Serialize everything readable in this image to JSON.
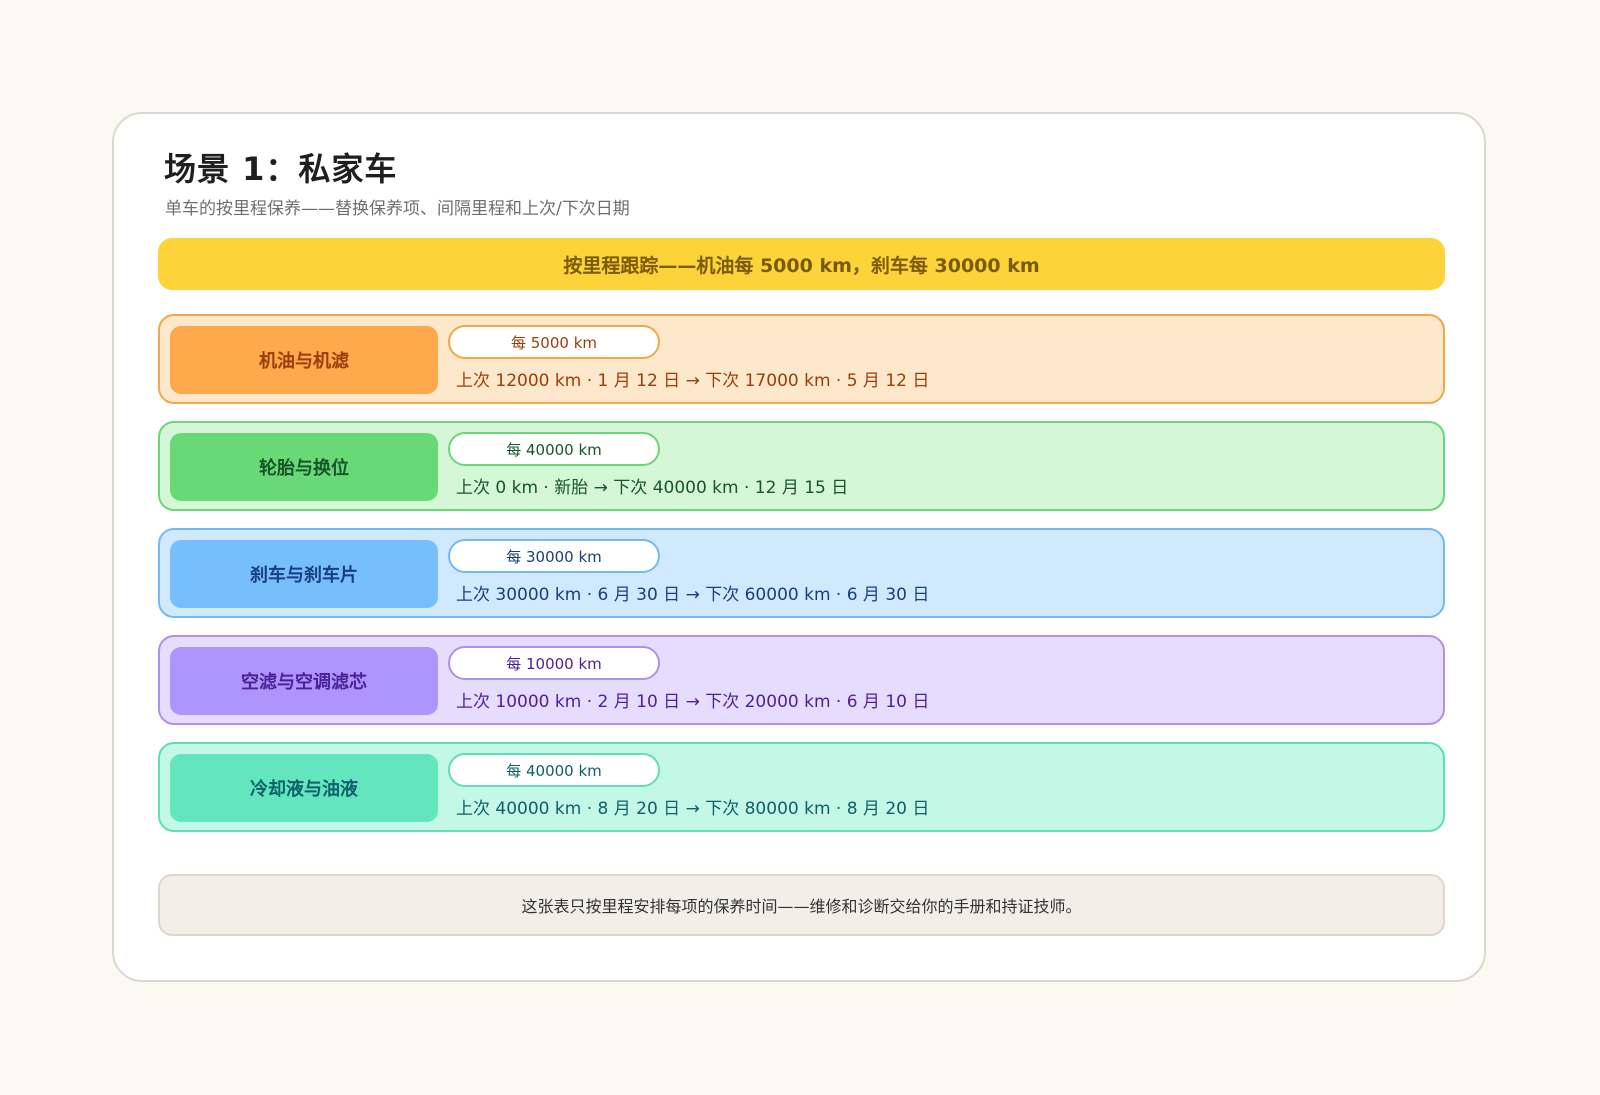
{
  "header": {
    "title": "场景 1：私家车",
    "subtitle": "单车的按里程保养——替换保养项、间隔里程和上次/下次日期"
  },
  "banner": {
    "text": "按里程跟踪——机油每 5000 km，刹车每 30000 km",
    "color": "#fdd33a"
  },
  "items": [
    {
      "label": "机油与机滤",
      "interval": "每 5000 km",
      "schedule": "上次 12000 km · 1 月 12 日 → 下次 17000 km · 5 月 12 日",
      "theme": "orange",
      "color": "#fea94c"
    },
    {
      "label": "轮胎与换位",
      "interval": "每 40000 km",
      "schedule": "上次 0 km · 新胎 → 下次 40000 km · 12 月 15 日",
      "theme": "green",
      "color": "#69d877"
    },
    {
      "label": "刹车与刹车片",
      "interval": "每 30000 km",
      "schedule": "上次 30000 km · 6 月 30 日 → 下次 60000 km · 6 月 30 日",
      "theme": "blue",
      "color": "#76bffc"
    },
    {
      "label": "空滤与空调滤芯",
      "interval": "每 10000 km",
      "schedule": "上次 10000 km · 2 月 10 日 → 下次 20000 km · 6 月 10 日",
      "theme": "purple",
      "color": "#ae95fb"
    },
    {
      "label": "冷却液与油液",
      "interval": "每 40000 km",
      "schedule": "上次 40000 km · 8 月 20 日 → 下次 80000 km · 8 月 20 日",
      "theme": "teal",
      "color": "#63e6bd"
    }
  ],
  "footer": {
    "note": "这张表只按里程安排每项的保养时间——维修和诊断交给你的手册和持证技师。"
  }
}
